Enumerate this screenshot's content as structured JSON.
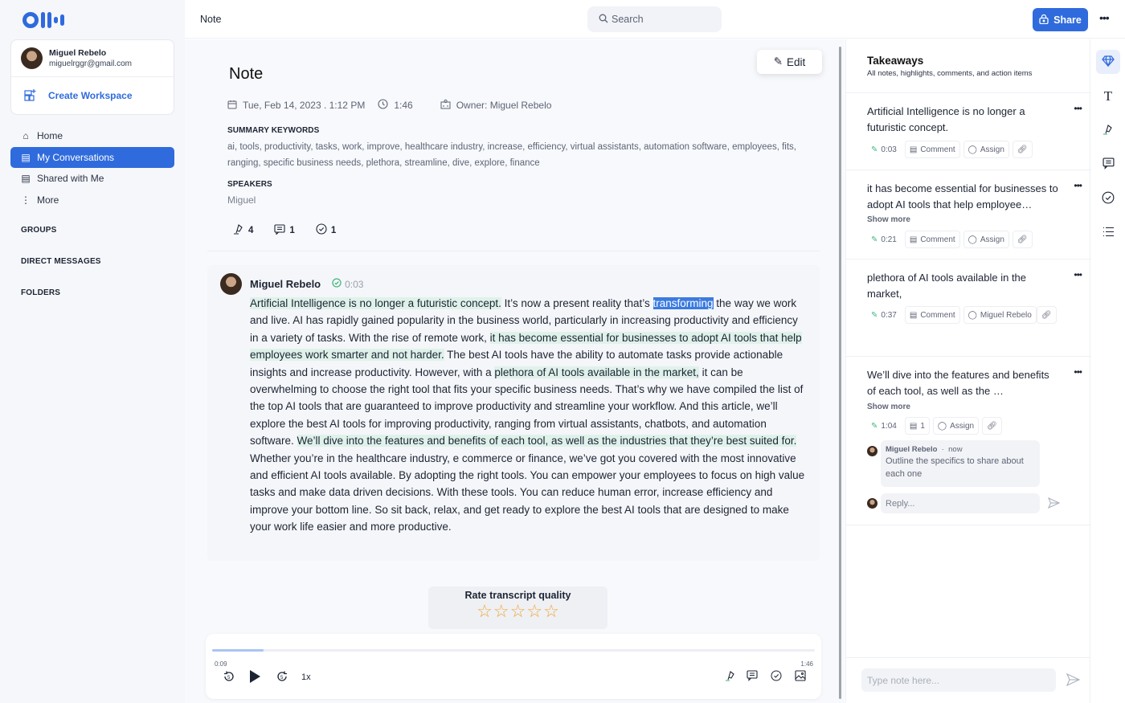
{
  "app": {
    "brand": "Otter",
    "top_title": "Note"
  },
  "account": {
    "name": "Miguel Rebelo",
    "email": "miguelrggr@gmail.com",
    "create_workspace": "Create Workspace"
  },
  "nav": {
    "items": [
      {
        "label": "Home",
        "icon": "home-icon"
      },
      {
        "label": "My Conversations",
        "icon": "conversations-icon",
        "active": true
      },
      {
        "label": "Shared with Me",
        "icon": "shared-icon"
      },
      {
        "label": "More",
        "icon": "more-vertical-icon"
      }
    ],
    "sections": [
      "GROUPS",
      "DIRECT MESSAGES",
      "FOLDERS"
    ]
  },
  "search": {
    "placeholder": "Search"
  },
  "share": {
    "label": "Share"
  },
  "note": {
    "title": "Note",
    "edit_label": "Edit",
    "date": "Tue, Feb 14, 2023 . 1:12 PM",
    "duration": "1:46",
    "owner": "Owner: Miguel Rebelo",
    "keywords_label": "SUMMARY KEYWORDS",
    "keywords": "ai, tools, productivity, tasks, work, improve, healthcare industry, increase, efficiency, virtual assistants, automation software, employees, fits, ranging, specific business needs, plethora, streamline, dive, explore, finance",
    "speakers_label": "SPEAKERS",
    "speakers": "Miguel",
    "counts": {
      "highlights": "4",
      "comments": "1",
      "action_items": "1"
    }
  },
  "transcript": {
    "speaker": "Miguel Rebelo",
    "timestamp": "0:03",
    "segments": [
      {
        "text": "Artificial Intelligence is no longer a futuristic concept.",
        "style": "hl"
      },
      {
        "text": " It’s now a present reality that’s ",
        "style": ""
      },
      {
        "text": "transforming",
        "style": "sel"
      },
      {
        "text": " the way we work and live. AI has rapidly gained popularity in the business world, particularly in increasing productivity and efficiency in a variety of tasks. With the rise of remote work, ",
        "style": ""
      },
      {
        "text": "it has become essential for businesses to adopt AI tools that help employees work smarter and not harder.",
        "style": "hl"
      },
      {
        "text": " The best AI tools have the ability to automate tasks provide actionable insights and increase productivity. However, with a ",
        "style": ""
      },
      {
        "text": "plethora of AI tools available in the market,",
        "style": "hl"
      },
      {
        "text": " it can be overwhelming to choose the right tool that fits your specific business needs. That’s why we have compiled the list of the top AI tools that are guaranteed to improve productivity and streamline your workflow. And this article, we’ll explore the best AI tools for improving productivity, ranging from virtual assistants, chatbots, and automation software. ",
        "style": ""
      },
      {
        "text": "We’ll dive into the features and benefits of each tool, as well as the industries that they’re best suited for.",
        "style": "hl"
      },
      {
        "text": " Whether you’re in the healthcare industry, e commerce or finance, we’ve got you covered with the most innovative and efficient AI tools available. By adopting the right tools. You can empower your employees to focus on high value tasks and make data driven decisions. With these tools. You can reduce human error, increase efficiency and improve your bottom line. So sit back, relax, and get ready to explore the best AI tools that are designed to make your work life easier and more productive.",
        "style": ""
      }
    ]
  },
  "rating": {
    "title": "Rate transcript quality",
    "stars_total": 5,
    "stars_filled": 0
  },
  "player": {
    "current": "0:09",
    "total": "1:46",
    "progress_fraction": 0.085,
    "speed": "1x"
  },
  "takeaways": {
    "title": "Takeaways",
    "subtitle": "All notes, highlights, comments, and action items",
    "items": [
      {
        "text": "Artificial Intelligence is no longer a futuristic concept.",
        "time": "0:03",
        "comment": "Comment",
        "assign": "Assign",
        "show_more": ""
      },
      {
        "text": "it has become essential for businesses to adopt AI tools that help employee…",
        "time": "0:21",
        "comment": "Comment",
        "assign": "Assign",
        "show_more": "Show more"
      },
      {
        "text": "plethora of AI tools available in the market,",
        "time": "0:37",
        "comment": "Comment",
        "assign": "Miguel Rebelo",
        "show_more": ""
      },
      {
        "text": "We’ll dive into the features and benefits of each tool, as well as the …",
        "time": "1:04",
        "comment": "1",
        "assign": "Assign",
        "show_more": "Show more"
      }
    ],
    "comment_thread": {
      "author": "Miguel Rebelo",
      "when": "now",
      "text": "Outline the specifics to share about each one",
      "reply_placeholder": "Reply..."
    },
    "note_placeholder": "Type note here..."
  },
  "rail": [
    "takeaways-icon",
    "text-icon",
    "highlight-icon",
    "comment-icon",
    "action-item-icon",
    "outline-icon"
  ]
}
